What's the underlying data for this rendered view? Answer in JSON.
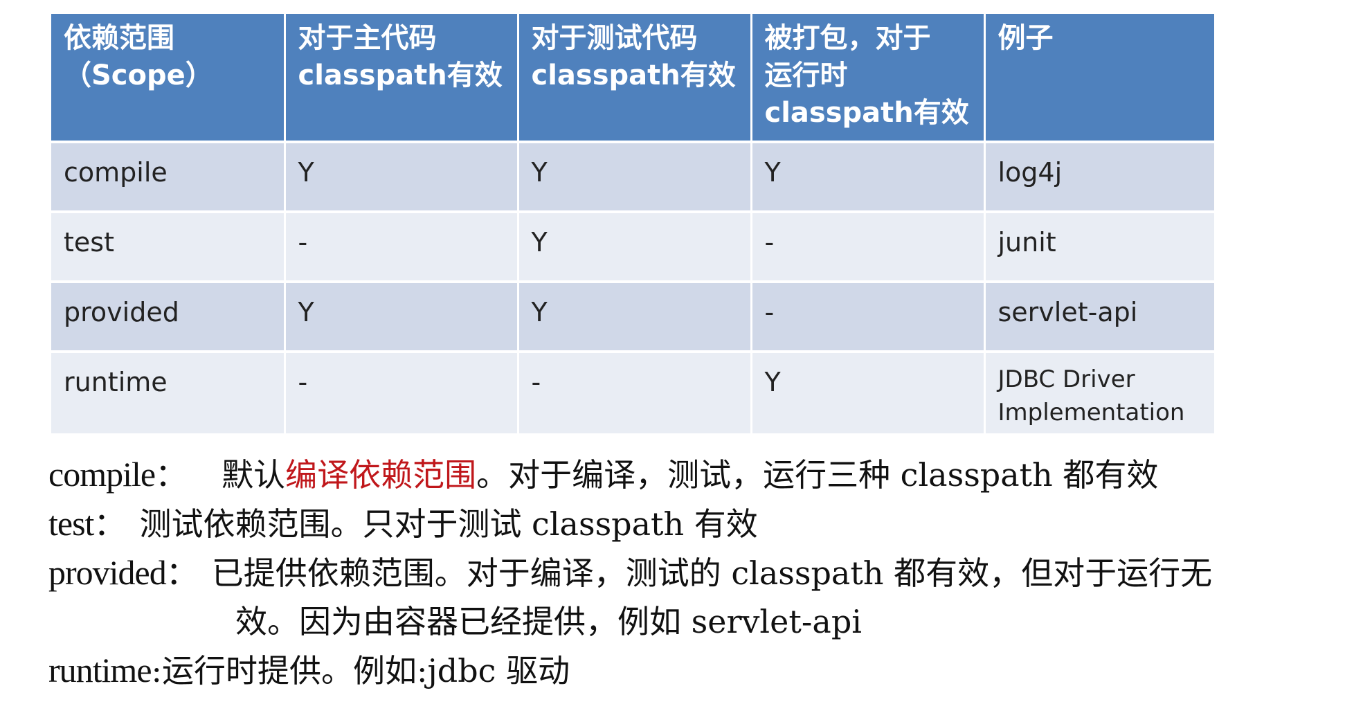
{
  "table": {
    "headers": [
      [
        "依赖范围",
        "（Scope）"
      ],
      [
        "对于主代码",
        "classpath有效"
      ],
      [
        "对于测试代码",
        "classpath有效"
      ],
      [
        "被打包，对于",
        "运行时",
        "classpath有效"
      ],
      [
        "例子"
      ]
    ],
    "rows": [
      {
        "scope": "compile",
        "main": "Y",
        "test": "Y",
        "runtime": "Y",
        "example": "log4j"
      },
      {
        "scope": "test",
        "main": "-",
        "test": "Y",
        "runtime": "-",
        "example": "junit"
      },
      {
        "scope": "provided",
        "main": "Y",
        "test": "Y",
        "runtime": "-",
        "example": "servlet-api"
      },
      {
        "scope": "runtime",
        "main": "-",
        "test": "-",
        "runtime": "Y",
        "example_lines": [
          "JDBC Driver",
          "Implementation"
        ]
      }
    ]
  },
  "notes": {
    "compile": {
      "term": "compile",
      "colon": "：",
      "pre": "默认",
      "highlight": "编译依赖范围",
      "post": "。对于编译，测试，运行三种 classpath 都有效"
    },
    "test": {
      "term": "test",
      "colon": "：",
      "text": "测试依赖范围。只对于测试 classpath 有效"
    },
    "provided": {
      "term": "provided",
      "colon": "：",
      "text": "已提供依赖范围。对于编译，测试的 classpath 都有效，但对于运行无",
      "continuation": "效。因为由容器已经提供，例如 servlet-api"
    },
    "runtime": {
      "term": "runtime",
      "colon": ":",
      "text": "运行时提供。例如:jdbc 驱动"
    }
  },
  "colors": {
    "header_bg": "#4f81bd",
    "row_odd_bg": "#d0d8e8",
    "row_even_bg": "#e9edf4",
    "highlight": "#c0171b"
  }
}
